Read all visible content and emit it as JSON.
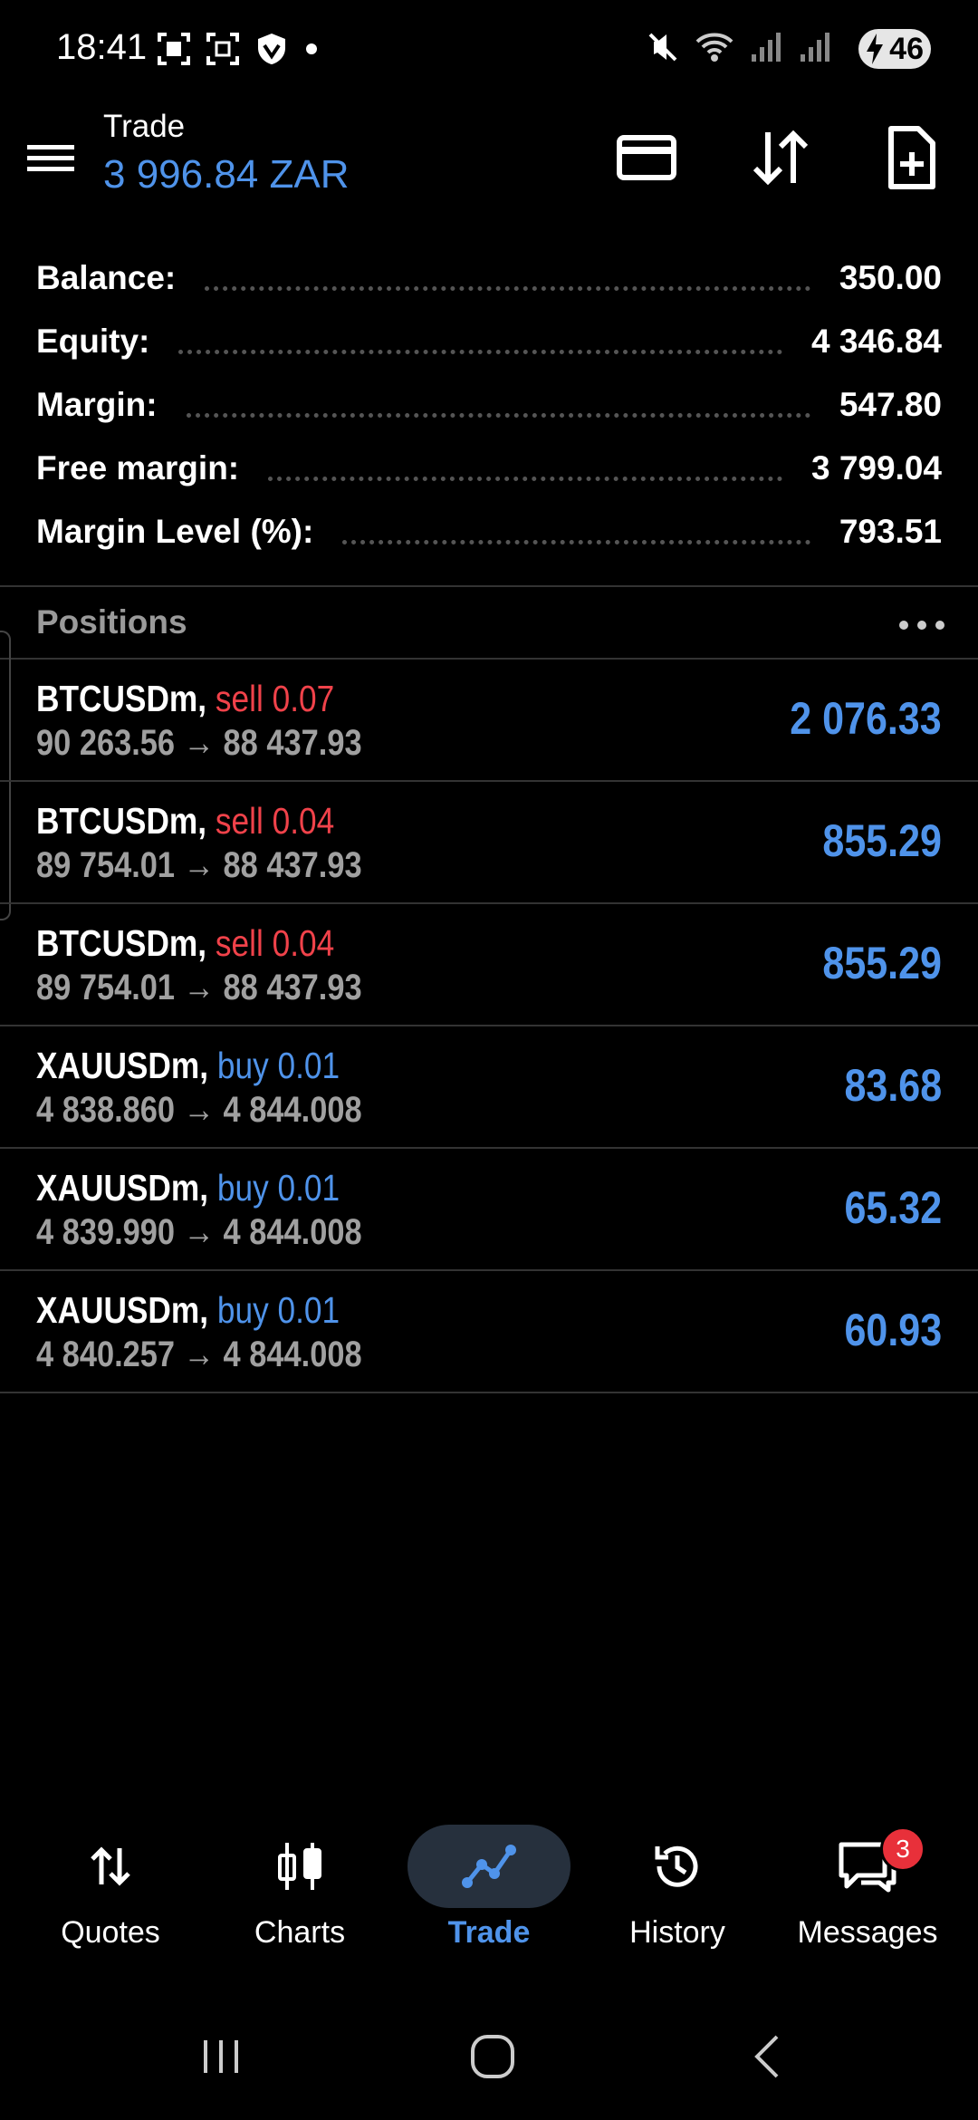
{
  "status_bar": {
    "time": "18:41",
    "battery": "46"
  },
  "header": {
    "title": "Trade",
    "subtitle": "3 996.84 ZAR"
  },
  "summary": [
    {
      "label": "Balance:",
      "value": "350.00"
    },
    {
      "label": "Equity:",
      "value": "4 346.84"
    },
    {
      "label": "Margin:",
      "value": "547.80"
    },
    {
      "label": "Free margin:",
      "value": "3 799.04"
    },
    {
      "label": "Margin Level (%):",
      "value": "793.51"
    }
  ],
  "positions_header": "Positions",
  "positions": [
    {
      "symbol": "BTCUSDm,",
      "side": "sell",
      "side_label": "sell 0.07",
      "prices": "90 263.56 → 88 437.93",
      "profit": "2 076.33"
    },
    {
      "symbol": "BTCUSDm,",
      "side": "sell",
      "side_label": "sell 0.04",
      "prices": "89 754.01 → 88 437.93",
      "profit": "855.29"
    },
    {
      "symbol": "BTCUSDm,",
      "side": "sell",
      "side_label": "sell 0.04",
      "prices": "89 754.01 → 88 437.93",
      "profit": "855.29"
    },
    {
      "symbol": "XAUUSDm,",
      "side": "buy",
      "side_label": "buy 0.01",
      "prices": "4 838.860 → 4 844.008",
      "profit": "83.68"
    },
    {
      "symbol": "XAUUSDm,",
      "side": "buy",
      "side_label": "buy 0.01",
      "prices": "4 839.990 → 4 844.008",
      "profit": "65.32"
    },
    {
      "symbol": "XAUUSDm,",
      "side": "buy",
      "side_label": "buy 0.01",
      "prices": "4 840.257 → 4 844.008",
      "profit": "60.93"
    }
  ],
  "nav": {
    "quotes": "Quotes",
    "charts": "Charts",
    "trade": "Trade",
    "history": "History",
    "messages": "Messages",
    "messages_badge": "3"
  },
  "colors": {
    "accent": "#4f93ea",
    "sell": "#f0424a",
    "muted": "#a0a0a0"
  }
}
